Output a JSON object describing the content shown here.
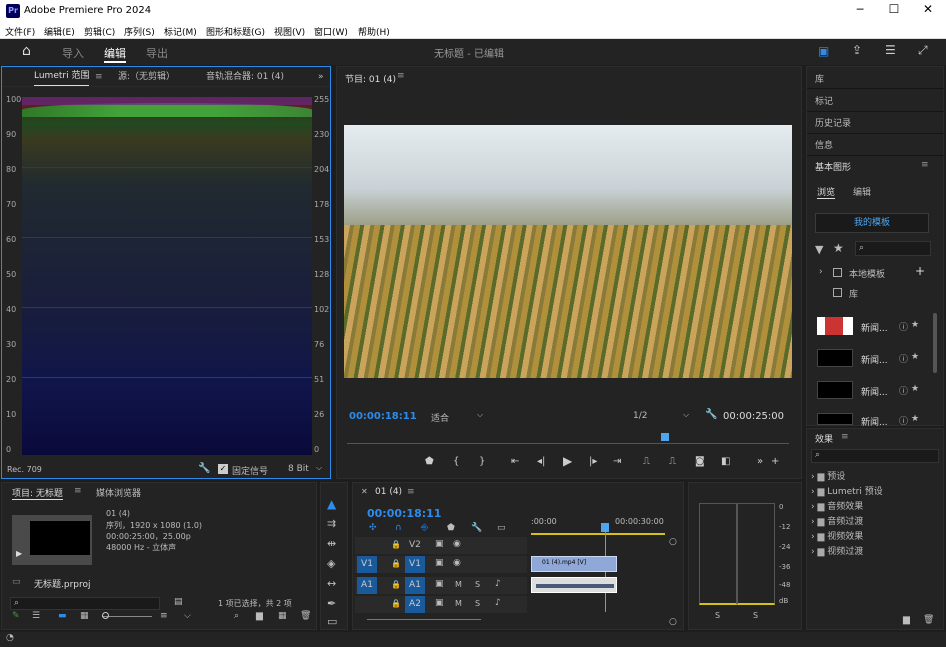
{
  "app": {
    "title": "Adobe Premiere Pro 2024",
    "logo": "Pr"
  },
  "menu": [
    "文件(F)",
    "编辑(E)",
    "剪辑(C)",
    "序列(S)",
    "标记(M)",
    "图形和标题(G)",
    "视图(V)",
    "窗口(W)",
    "帮助(H)"
  ],
  "workspace": {
    "tabs": [
      "导入",
      "编辑",
      "导出"
    ],
    "active": "编辑",
    "doc_title": "无标题 - 已编辑"
  },
  "lumetri": {
    "tabs": [
      "Lumetri 范围",
      "源:（无剪辑）",
      "音轨混合器: 01 (4)"
    ],
    "left_axis": [
      "100",
      "90",
      "80",
      "70",
      "60",
      "50",
      "40",
      "30",
      "20",
      "10",
      "0"
    ],
    "right_axis": [
      "255",
      "230",
      "204",
      "178",
      "153",
      "128",
      "102",
      "76",
      "51",
      "26",
      "0"
    ],
    "footer_left": "Rec. 709",
    "clamp_label": "固定信号",
    "bit_depth": "8 Bit"
  },
  "program": {
    "title": "节目: 01 (4)",
    "timecode": "00:00:18:11",
    "fit": "适合",
    "resolution": "1/2",
    "duration": "00:00:25:00",
    "playhead": 0.72
  },
  "right_panel": {
    "items": [
      "库",
      "标记",
      "历史记录",
      "信息"
    ],
    "essential": "基本图形",
    "tabs": [
      "浏览",
      "编辑"
    ],
    "my_templates": "我的模板",
    "tree": [
      "本地模板",
      "库"
    ],
    "templates": [
      "新闻...",
      "新闻...",
      "新闻...",
      "新闻..."
    ]
  },
  "effects": {
    "title": "效果",
    "items": [
      "预设",
      "Lumetri 预设",
      "音频效果",
      "音频过渡",
      "视频效果",
      "视频过渡"
    ]
  },
  "project": {
    "tabs": [
      "项目: 无标题",
      "媒体浏览器"
    ],
    "clip_name": "01 (4)",
    "clip_info": [
      "序列，1920 x 1080 (1.0)",
      "00:00:25:00，25.00p",
      "48000 Hz - 立体声"
    ],
    "file": "无标题.prproj",
    "selection": "1 项已选择，共 2 项"
  },
  "timeline": {
    "tab": "01 (4)",
    "timecode": "00:00:18:11",
    "ruler": [
      ":00:00",
      "00:00:30:00"
    ],
    "tracks": [
      {
        "name": "V2",
        "target": ""
      },
      {
        "name": "V1",
        "target": "V1"
      },
      {
        "name": "A1",
        "target": "A1"
      },
      {
        "name": "A2",
        "target": "A2"
      }
    ],
    "clip_label": "01 (4).mp4 [V]",
    "playhead": 0.55
  },
  "audio_meter": {
    "scale": [
      "0",
      "-12",
      "-24",
      "-36",
      "-48",
      "dB"
    ],
    "channels": [
      "S",
      "S"
    ]
  },
  "colors": {
    "accent": "#2d8ceb",
    "bg": "#232323",
    "panel_border": "#2d2d2d"
  }
}
